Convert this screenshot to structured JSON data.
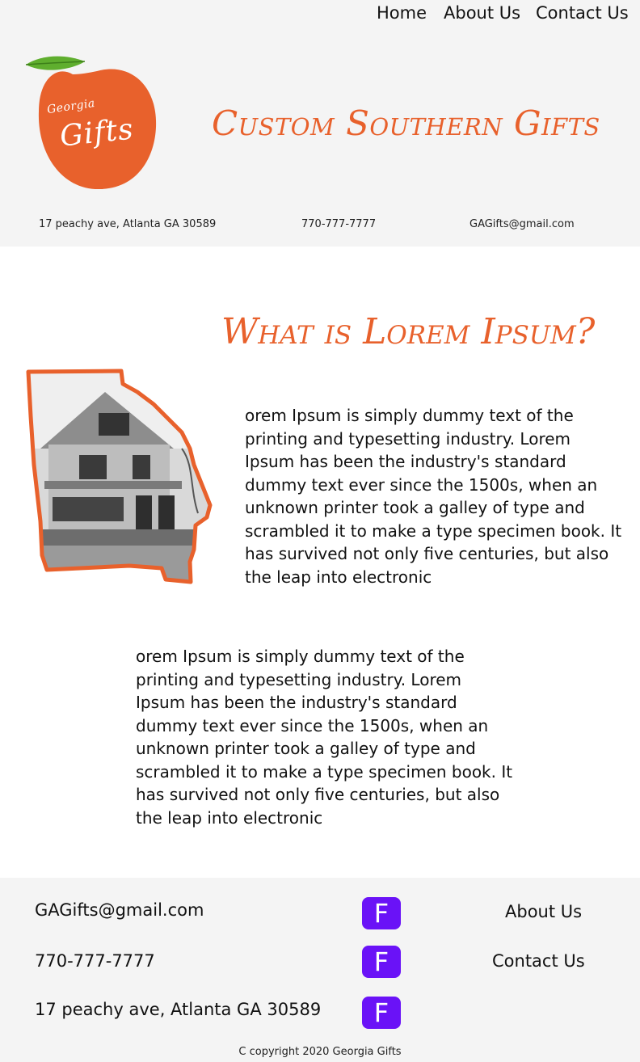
{
  "nav": {
    "home": "Home",
    "about": "About Us",
    "contact": "Contact Us"
  },
  "logo": {
    "small_text": "Georgia",
    "big_text": "Gifts"
  },
  "header": {
    "title": "Custom Southern Gifts",
    "address": "17 peachy ave, Atlanta GA 30589",
    "phone": "770-777-7777",
    "email": "GAGifts@gmail.com"
  },
  "main": {
    "heading": "What is Lorem Ipsum?",
    "paragraph_1": "orem Ipsum is simply dummy text of the printing and typesetting industry. Lorem Ipsum has been the industry's standard dummy text ever since the 1500s, when an unknown printer took a galley of type and scrambled it to make a type specimen book. It has survived not only five centuries, but also the leap into electronic",
    "paragraph_2": "orem Ipsum is simply dummy text of the printing and typesetting industry. Lorem Ipsum has been the industry's standard dummy text ever since the 1500s, when an unknown printer took a galley of type and scrambled it to make a type specimen book. It has survived not only five centuries, but also the leap into electronic"
  },
  "footer": {
    "email": "GAGifts@gmail.com",
    "phone": "770-777-7777",
    "address": "17 peachy ave, Atlanta GA 30589",
    "social_icon_label": "F",
    "about_link": "About Us",
    "contact_link": "Contact Us",
    "copyright": "C copyright 2020 Georgia Gifts"
  },
  "colors": {
    "accent_orange": "#e8612c",
    "social_purple": "#6a12f7",
    "band_gray": "#f4f4f4"
  },
  "icons": {
    "logo": "peach-logo-icon",
    "social": "facebook-icon"
  }
}
